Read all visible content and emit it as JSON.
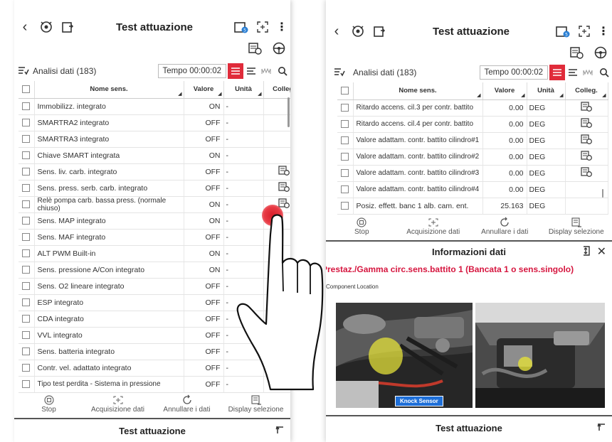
{
  "left": {
    "title": "Test attuazione",
    "analysis_title": "Analisi dati (183)",
    "time_label": "Tempo 00:00:02",
    "headers": {
      "name": "Nome sens.",
      "value": "Valore",
      "unit": "Unità",
      "link": "Colleg."
    },
    "rows": [
      {
        "name": "Immobilizz. integrato",
        "value": "ON",
        "unit": "-",
        "link": false
      },
      {
        "name": "SMARTRA2 integrato",
        "value": "OFF",
        "unit": "-",
        "link": false
      },
      {
        "name": "SMARTRA3 integrato",
        "value": "OFF",
        "unit": "-",
        "link": false
      },
      {
        "name": "Chiave SMART integrata",
        "value": "ON",
        "unit": "-",
        "link": false
      },
      {
        "name": "Sens. liv. carb. integrato",
        "value": "OFF",
        "unit": "-",
        "link": true
      },
      {
        "name": "Sens. press. serb. carb. integrato",
        "value": "OFF",
        "unit": "-",
        "link": true
      },
      {
        "name": "Relè pompa carb. bassa press. (normale chiuso)",
        "value": "ON",
        "unit": "-",
        "link": true
      },
      {
        "name": "Sens. MAP integrato",
        "value": "ON",
        "unit": "-",
        "link": false
      },
      {
        "name": "Sens. MAF integrato",
        "value": "OFF",
        "unit": "-",
        "link": false
      },
      {
        "name": "ALT PWM Built-in",
        "value": "ON",
        "unit": "-",
        "link": false
      },
      {
        "name": "Sens. pressione A/Con integrato",
        "value": "ON",
        "unit": "-",
        "link": false
      },
      {
        "name": "Sens. O2 lineare integrato",
        "value": "OFF",
        "unit": "-",
        "link": false
      },
      {
        "name": "ESP integrato",
        "value": "OFF",
        "unit": "-",
        "link": false
      },
      {
        "name": "CDA integrato",
        "value": "OFF",
        "unit": "-",
        "link": false
      },
      {
        "name": "VVL integrato",
        "value": "OFF",
        "unit": "-",
        "link": false
      },
      {
        "name": "Sens. batteria integrato",
        "value": "OFF",
        "unit": "-",
        "link": false
      },
      {
        "name": "Contr. vel. adattato integrato",
        "value": "OFF",
        "unit": "-",
        "link": false
      },
      {
        "name": "Tipo test perdita - Sistema in pressione",
        "value": "OFF",
        "unit": "-",
        "link": false
      }
    ],
    "bottom_buttons": [
      {
        "label": "Stop",
        "icon": "stop-icon"
      },
      {
        "label": "Acquisizione dati",
        "icon": "capture-icon"
      },
      {
        "label": "Annullare i dati",
        "icon": "refresh-icon"
      },
      {
        "label": "Display selezione",
        "icon": "display-selection-icon"
      }
    ],
    "footer": "Test attuazione"
  },
  "right": {
    "title": "Test attuazione",
    "analysis_title": "Analisi dati (183)",
    "time_label": "Tempo 00:00:02",
    "headers": {
      "name": "Nome sens.",
      "value": "Valore",
      "unit": "Unità",
      "link": "Colleg."
    },
    "rows": [
      {
        "name": "Ritardo accens. cil.3 per contr. battito",
        "value": "0.00",
        "unit": "DEG",
        "link": true
      },
      {
        "name": "Ritardo accens. cil.4 per contr. battito",
        "value": "0.00",
        "unit": "DEG",
        "link": true
      },
      {
        "name": "Valore adattam. contr. battito cilindro#1",
        "value": "0.00",
        "unit": "DEG",
        "link": true
      },
      {
        "name": "Valore adattam. contr. battito cilindro#2",
        "value": "0.00",
        "unit": "DEG",
        "link": true
      },
      {
        "name": "Valore adattam. contr. battito cilindro#3",
        "value": "0.00",
        "unit": "DEG",
        "link": true
      },
      {
        "name": "Valore adattam. contr. battito cilindro#4",
        "value": "0.00",
        "unit": "DEG",
        "link": false
      },
      {
        "name": "Posiz. effett. banc 1 alb. cam. ent.",
        "value": "25.163",
        "unit": "DEG",
        "link": false
      }
    ],
    "bottom_buttons": [
      {
        "label": "Stop",
        "icon": "stop-icon"
      },
      {
        "label": "Acquisizione dati",
        "icon": "capture-icon"
      },
      {
        "label": "Annullare i dati",
        "icon": "refresh-icon"
      },
      {
        "label": "Display selezione",
        "icon": "display-selection-icon"
      }
    ],
    "info": {
      "heading": "Informazioni dati",
      "title": "Prestaz./Gamma circ.sens.battito 1 (Bancata 1 o sens.singolo)",
      "subtitle": "Component Location",
      "photo_label": "Knock Sensor"
    },
    "footer": "Test attuazione"
  },
  "colors": {
    "accent": "#e02b3a",
    "info_title": "#d6163f",
    "label_blue": "#1e6fd8"
  }
}
